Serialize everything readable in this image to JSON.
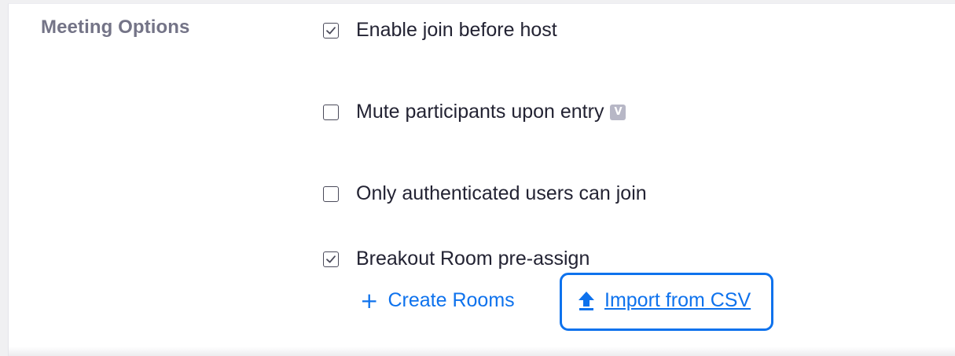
{
  "section": {
    "label": "Meeting Options"
  },
  "options": [
    {
      "label": "Enable join before host",
      "checked": true
    },
    {
      "label": "Mute participants upon entry",
      "checked": false,
      "badge_icon": "version-badge-icon",
      "badge_text": "V"
    },
    {
      "label": "Only authenticated users can join",
      "checked": false
    },
    {
      "label": "Breakout Room pre-assign",
      "checked": true
    }
  ],
  "breakout": {
    "create_rooms_label": "Create Rooms",
    "create_rooms_icon": "plus-icon",
    "import_label": "Import from CSV",
    "import_icon": "upload-arrow-icon"
  },
  "colors": {
    "accent": "#0e72ed",
    "section_label": "#747487",
    "text": "#232333",
    "badge": "#b7b7c6"
  }
}
